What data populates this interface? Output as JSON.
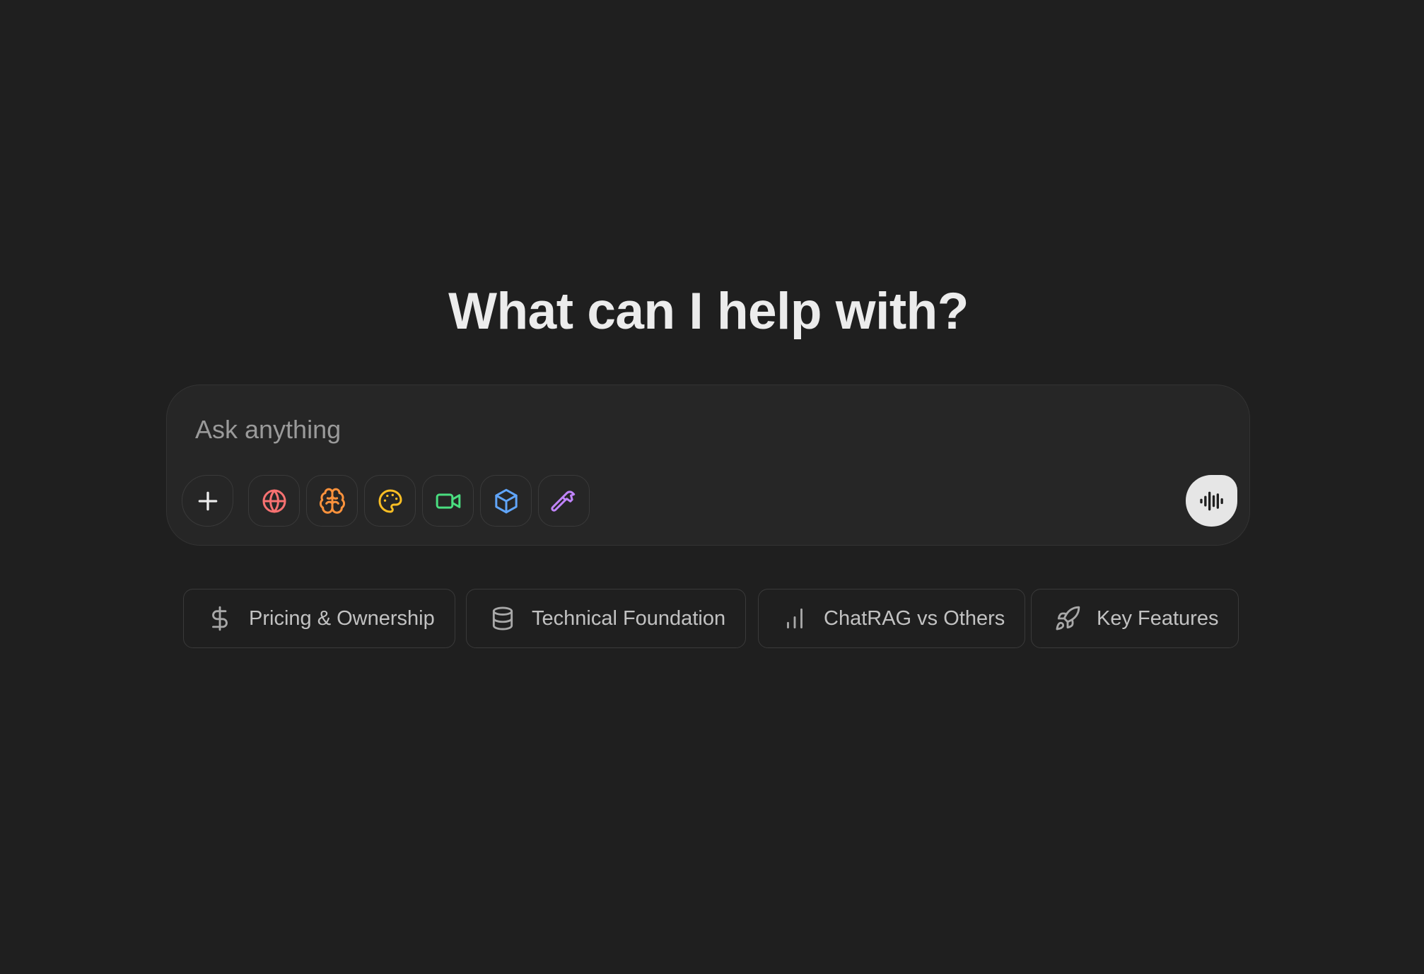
{
  "heading": "What can I help with?",
  "composer": {
    "placeholder": "Ask anything",
    "tools": [
      {
        "icon": "plus-icon",
        "color": "#ececec"
      },
      {
        "icon": "globe-icon",
        "color": "#f87171"
      },
      {
        "icon": "brain-icon",
        "color": "#fb923c"
      },
      {
        "icon": "palette-icon",
        "color": "#fbbf24"
      },
      {
        "icon": "video-icon",
        "color": "#4ade80"
      },
      {
        "icon": "cube-icon",
        "color": "#60a5fa"
      },
      {
        "icon": "hammer-icon",
        "color": "#c084fc"
      }
    ],
    "voice_icon": "audio-waveform-icon"
  },
  "suggestions": [
    {
      "label": "Pricing & Ownership",
      "icon": "dollar-icon"
    },
    {
      "label": "Technical Foundation",
      "icon": "database-icon"
    },
    {
      "label": "ChatRAG vs Others",
      "icon": "bar-chart-icon"
    },
    {
      "label": "Key Features",
      "icon": "rocket-icon"
    }
  ]
}
